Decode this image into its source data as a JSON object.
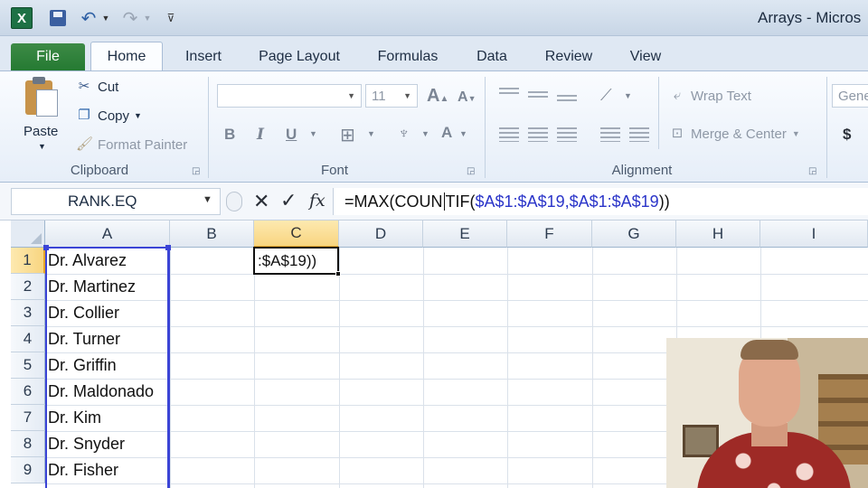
{
  "titlebar": {
    "app_logo": "X",
    "doc_title": "Arrays  -  Micros"
  },
  "tabs": [
    "File",
    "Home",
    "Insert",
    "Page Layout",
    "Formulas",
    "Data",
    "Review",
    "View"
  ],
  "ribbon": {
    "clipboard": {
      "paste": "Paste",
      "cut": "Cut",
      "copy": "Copy",
      "format_painter": "Format Painter",
      "label": "Clipboard"
    },
    "font": {
      "font_name": "",
      "font_size": "11",
      "bold": "B",
      "italic": "I",
      "underline": "U",
      "grow": "A",
      "shrink": "A",
      "font_color": "A",
      "label": "Font"
    },
    "alignment": {
      "wrap_text": "Wrap Text",
      "merge_center": "Merge & Center",
      "label": "Alignment"
    },
    "number": {
      "format": "Gene",
      "currency": "$"
    }
  },
  "formula_bar": {
    "name_box": "RANK.EQ",
    "cancel_glyph": "✕",
    "enter_glyph": "✓",
    "fx": "fx",
    "formula_prefix": "=MAX(COUN",
    "formula_prefix2": "TIF(",
    "formula_ref": "$A$1:$A$19,$A$1:$A$19",
    "formula_suffix": "))"
  },
  "grid": {
    "columns": [
      "A",
      "B",
      "C",
      "D",
      "E",
      "F",
      "G",
      "H",
      "I"
    ],
    "rows": [
      "1",
      "2",
      "3",
      "4",
      "5",
      "6",
      "7",
      "8",
      "9"
    ],
    "column_a_values": [
      "Dr. Alvarez",
      "Dr. Martinez",
      "Dr. Collier",
      "Dr. Turner",
      "Dr. Griffin",
      "Dr. Maldonado",
      "Dr. Kim",
      "Dr. Snyder",
      "Dr. Fisher"
    ],
    "active_cell_text": ":$A$19))",
    "active_column": "C",
    "active_row": "1"
  },
  "colors": {
    "file_tab": "#257a32",
    "reference_blue": "#2b35c9",
    "selection_header": "#f8d580"
  }
}
